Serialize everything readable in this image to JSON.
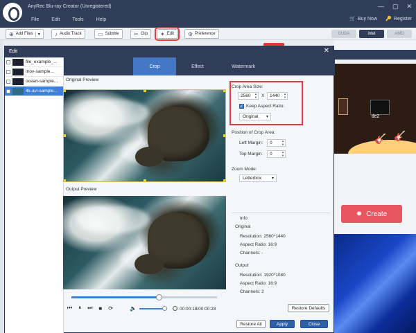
{
  "app": {
    "title": "AnyRec Blu-ray Creator (Unregistered)",
    "menu": [
      "File",
      "Edit",
      "Tools",
      "Help"
    ],
    "buy_now": "Buy Now",
    "register": "Register",
    "window_controls": [
      "—",
      "▢",
      "✕"
    ]
  },
  "toolbar": {
    "add_files": "Add Files",
    "audio_track": "Audio Track",
    "subtitle": "Subtitle",
    "clip": "Clip",
    "edit": "Edit",
    "preference": "Preference",
    "accel": [
      "CUDA",
      "intel",
      "AMD"
    ]
  },
  "background": {
    "menu_title_partial": "tle2",
    "create_label": "Create"
  },
  "dialog": {
    "title": "Edit",
    "files": [
      {
        "name": "file_example_...",
        "selected": false
      },
      {
        "name": "mov-sample...",
        "selected": false
      },
      {
        "name": "ocean-sample...",
        "selected": false
      },
      {
        "name": "4k-avi-sample...",
        "selected": true
      }
    ],
    "tabs": [
      "Crop",
      "Effect",
      "Watermark"
    ],
    "active_tab": "Crop",
    "original_preview": "Original Preview",
    "output_preview": "Output Preview",
    "player": {
      "timecode": "00:00:18/00:00:28",
      "progress_percent": 60,
      "volume_percent": 90
    },
    "crop": {
      "area_size_label": "Crop Area Size:",
      "width": "2560",
      "x_sep": "X",
      "height": "1440",
      "keep_aspect_label": "Keep Aspect Ratio:",
      "keep_aspect_checked": true,
      "aspect_value": "Original",
      "position_label": "Position of Crop Area:",
      "left_margin_label": "Left Margin:",
      "left_margin": "0",
      "top_margin_label": "Top Margin:",
      "top_margin": "0",
      "zoom_label": "Zoom Mode:",
      "zoom_value": "Letterbox"
    },
    "info": {
      "heading": "Info",
      "original_label": "Original",
      "orig_resolution": "Resolution: 2560*1440",
      "orig_aspect": "Aspect Ratio: 16:9",
      "orig_channels": "Channels: -",
      "output_label": "Output",
      "out_resolution": "Resolution: 1920*1080",
      "out_aspect": "Aspect Ratio: 16:9",
      "out_channels": "Channels: 2"
    },
    "buttons": {
      "restore_defaults": "Restore Defaults",
      "restore_all": "Restore All",
      "apply": "Apply",
      "close": "Close"
    }
  },
  "colors": {
    "header": "#2f3d59",
    "accent": "#4478c4",
    "highlight_red": "#e23a3a"
  }
}
